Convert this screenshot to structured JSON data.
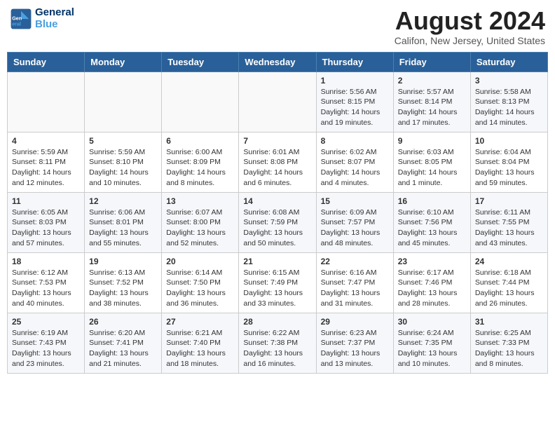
{
  "header": {
    "logo_line1": "General",
    "logo_line2": "Blue",
    "month_year": "August 2024",
    "location": "Califon, New Jersey, United States"
  },
  "weekdays": [
    "Sunday",
    "Monday",
    "Tuesday",
    "Wednesday",
    "Thursday",
    "Friday",
    "Saturday"
  ],
  "weeks": [
    [
      {
        "day": "",
        "info": ""
      },
      {
        "day": "",
        "info": ""
      },
      {
        "day": "",
        "info": ""
      },
      {
        "day": "",
        "info": ""
      },
      {
        "day": "1",
        "info": "Sunrise: 5:56 AM\nSunset: 8:15 PM\nDaylight: 14 hours\nand 19 minutes."
      },
      {
        "day": "2",
        "info": "Sunrise: 5:57 AM\nSunset: 8:14 PM\nDaylight: 14 hours\nand 17 minutes."
      },
      {
        "day": "3",
        "info": "Sunrise: 5:58 AM\nSunset: 8:13 PM\nDaylight: 14 hours\nand 14 minutes."
      }
    ],
    [
      {
        "day": "4",
        "info": "Sunrise: 5:59 AM\nSunset: 8:11 PM\nDaylight: 14 hours\nand 12 minutes."
      },
      {
        "day": "5",
        "info": "Sunrise: 5:59 AM\nSunset: 8:10 PM\nDaylight: 14 hours\nand 10 minutes."
      },
      {
        "day": "6",
        "info": "Sunrise: 6:00 AM\nSunset: 8:09 PM\nDaylight: 14 hours\nand 8 minutes."
      },
      {
        "day": "7",
        "info": "Sunrise: 6:01 AM\nSunset: 8:08 PM\nDaylight: 14 hours\nand 6 minutes."
      },
      {
        "day": "8",
        "info": "Sunrise: 6:02 AM\nSunset: 8:07 PM\nDaylight: 14 hours\nand 4 minutes."
      },
      {
        "day": "9",
        "info": "Sunrise: 6:03 AM\nSunset: 8:05 PM\nDaylight: 14 hours\nand 1 minute."
      },
      {
        "day": "10",
        "info": "Sunrise: 6:04 AM\nSunset: 8:04 PM\nDaylight: 13 hours\nand 59 minutes."
      }
    ],
    [
      {
        "day": "11",
        "info": "Sunrise: 6:05 AM\nSunset: 8:03 PM\nDaylight: 13 hours\nand 57 minutes."
      },
      {
        "day": "12",
        "info": "Sunrise: 6:06 AM\nSunset: 8:01 PM\nDaylight: 13 hours\nand 55 minutes."
      },
      {
        "day": "13",
        "info": "Sunrise: 6:07 AM\nSunset: 8:00 PM\nDaylight: 13 hours\nand 52 minutes."
      },
      {
        "day": "14",
        "info": "Sunrise: 6:08 AM\nSunset: 7:59 PM\nDaylight: 13 hours\nand 50 minutes."
      },
      {
        "day": "15",
        "info": "Sunrise: 6:09 AM\nSunset: 7:57 PM\nDaylight: 13 hours\nand 48 minutes."
      },
      {
        "day": "16",
        "info": "Sunrise: 6:10 AM\nSunset: 7:56 PM\nDaylight: 13 hours\nand 45 minutes."
      },
      {
        "day": "17",
        "info": "Sunrise: 6:11 AM\nSunset: 7:55 PM\nDaylight: 13 hours\nand 43 minutes."
      }
    ],
    [
      {
        "day": "18",
        "info": "Sunrise: 6:12 AM\nSunset: 7:53 PM\nDaylight: 13 hours\nand 40 minutes."
      },
      {
        "day": "19",
        "info": "Sunrise: 6:13 AM\nSunset: 7:52 PM\nDaylight: 13 hours\nand 38 minutes."
      },
      {
        "day": "20",
        "info": "Sunrise: 6:14 AM\nSunset: 7:50 PM\nDaylight: 13 hours\nand 36 minutes."
      },
      {
        "day": "21",
        "info": "Sunrise: 6:15 AM\nSunset: 7:49 PM\nDaylight: 13 hours\nand 33 minutes."
      },
      {
        "day": "22",
        "info": "Sunrise: 6:16 AM\nSunset: 7:47 PM\nDaylight: 13 hours\nand 31 minutes."
      },
      {
        "day": "23",
        "info": "Sunrise: 6:17 AM\nSunset: 7:46 PM\nDaylight: 13 hours\nand 28 minutes."
      },
      {
        "day": "24",
        "info": "Sunrise: 6:18 AM\nSunset: 7:44 PM\nDaylight: 13 hours\nand 26 minutes."
      }
    ],
    [
      {
        "day": "25",
        "info": "Sunrise: 6:19 AM\nSunset: 7:43 PM\nDaylight: 13 hours\nand 23 minutes."
      },
      {
        "day": "26",
        "info": "Sunrise: 6:20 AM\nSunset: 7:41 PM\nDaylight: 13 hours\nand 21 minutes."
      },
      {
        "day": "27",
        "info": "Sunrise: 6:21 AM\nSunset: 7:40 PM\nDaylight: 13 hours\nand 18 minutes."
      },
      {
        "day": "28",
        "info": "Sunrise: 6:22 AM\nSunset: 7:38 PM\nDaylight: 13 hours\nand 16 minutes."
      },
      {
        "day": "29",
        "info": "Sunrise: 6:23 AM\nSunset: 7:37 PM\nDaylight: 13 hours\nand 13 minutes."
      },
      {
        "day": "30",
        "info": "Sunrise: 6:24 AM\nSunset: 7:35 PM\nDaylight: 13 hours\nand 10 minutes."
      },
      {
        "day": "31",
        "info": "Sunrise: 6:25 AM\nSunset: 7:33 PM\nDaylight: 13 hours\nand 8 minutes."
      }
    ]
  ]
}
